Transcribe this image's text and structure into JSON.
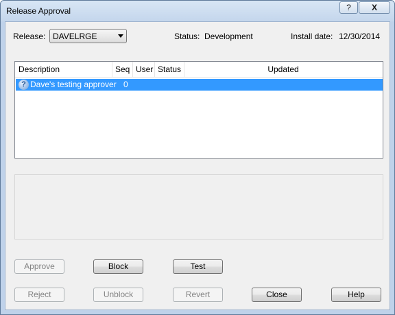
{
  "window": {
    "title": "Release Approval",
    "help_glyph": "?",
    "close_glyph": "X"
  },
  "header": {
    "release_label": "Release:",
    "release_value": "DAVELRGE",
    "status_label": "Status:",
    "status_value": "Development",
    "install_label": "Install date:",
    "install_value": "12/30/2014"
  },
  "list": {
    "columns": [
      "Description",
      "Seq",
      "User",
      "Status",
      "Updated"
    ],
    "rows": [
      {
        "icon": "question-icon",
        "description": "Dave's testing approver",
        "seq": "0",
        "user": "",
        "status": "",
        "updated": ""
      }
    ],
    "selected_color": "#3399ff"
  },
  "buttons": {
    "approve": "Approve",
    "block": "Block",
    "test": "Test",
    "reject": "Reject",
    "unblock": "Unblock",
    "revert": "Revert",
    "close": "Close",
    "help": "Help"
  }
}
